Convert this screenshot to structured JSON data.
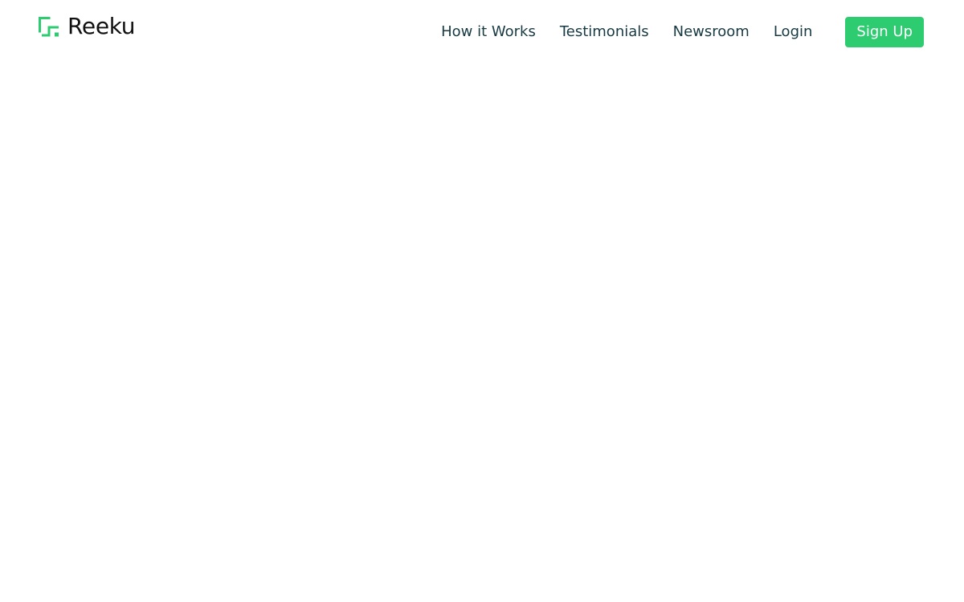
{
  "brand": {
    "name": "Reeku",
    "logo_icon": "reeku-logo-icon",
    "logo_color": "#2ecc71"
  },
  "nav": {
    "links": [
      {
        "label": "How it Works"
      },
      {
        "label": "Testimonials"
      },
      {
        "label": "Newsroom"
      },
      {
        "label": "Login"
      }
    ],
    "signup_label": "Sign Up",
    "link_color": "#173a43",
    "accent_color": "#2ecc71"
  }
}
